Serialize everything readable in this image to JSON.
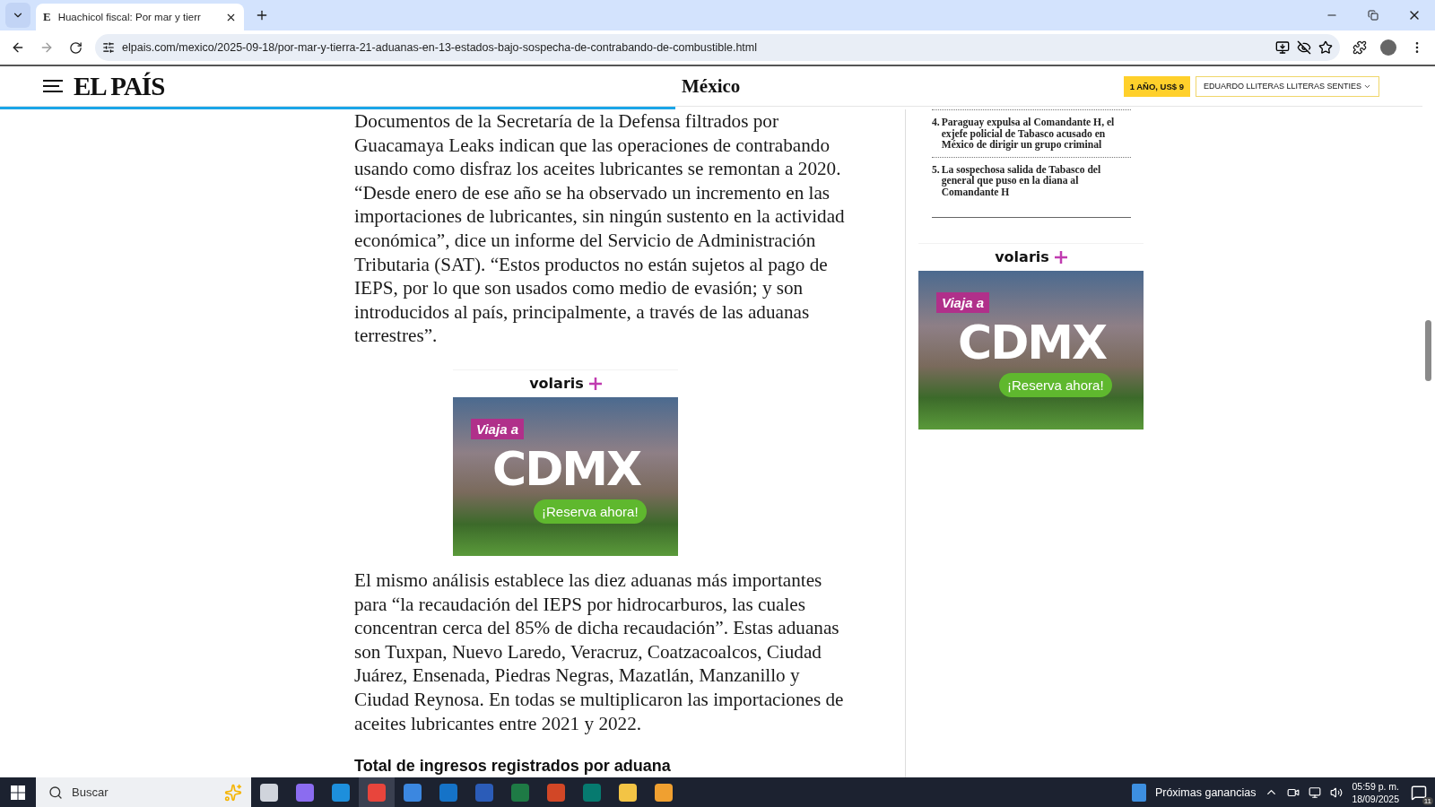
{
  "browser": {
    "tabs": [
      {
        "favicon": "E",
        "title": "Huachicol fiscal: Por mar y tierr",
        "selected": true
      }
    ],
    "url": "elpais.com/mexico/2025-09-18/por-mar-y-tierra-21-aduanas-en-13-estados-bajo-sospecha-de-contrabando-de-combustible.html"
  },
  "site_header": {
    "logo": "EL PAÍS",
    "section": "México",
    "subscribe_button": "1 AÑO, US$ 9",
    "user_menu": "EDUARDO LLITERAS LLITERAS SENTIES",
    "reading_progress": {
      "level": 0.475
    }
  },
  "article": {
    "blocks": [
      {
        "kind": "paragraph",
        "text": "Documentos de la Secretaría de la Defensa filtrados por Guacamaya Leaks indican que las operaciones de contrabando usando como disfraz los aceites lubricantes se remontan a 2020. “Desde enero de ese año se ha observado un incremento en las importaciones de lubricantes, sin ningún sustento en la actividad económica”, dice un informe del Servicio de Administración Tributaria (SAT). “Estos productos no están sujetos al pago de IEPS, por lo que son usados como medio de evasión; y son introducidos al país, principalmente, a través de las aduanas terrestres”."
      },
      {
        "kind": "ad",
        "brand": "volaris",
        "tag": "Viaja a",
        "headline": "CDMX",
        "cta": "¡Reserva ahora!"
      },
      {
        "kind": "paragraph",
        "text": "El mismo análisis establece las diez aduanas más importantes para “la recaudación del IEPS por hidrocarburos, las cuales concentran cerca del 85% de dicha recaudación”. Estas aduanas son Tuxpan, Nuevo Laredo, Veracruz, Coatzacoalcos, Ciudad Juárez, Ensenada, Piedras Negras, Mazatlán, Manzanillo y Ciudad Reynosa. En todas se multiplicaron las importaciones de aceites lubricantes entre 2021 y 2022."
      },
      {
        "kind": "heading",
        "text": "Total de ingresos registrados por aduana"
      }
    ]
  },
  "sidebar": {
    "most_read": [
      {
        "number": "4.",
        "title": "Paraguay expulsa al Comandante H, el exjefe policial de Tabasco acusado en México de dirigir un grupo criminal"
      },
      {
        "number": "5.",
        "title": "La sospechosa salida de Tabasco del general que puso en la diana al Comandante H"
      }
    ],
    "ad": {
      "brand": "volaris",
      "tag": "Viaja a",
      "headline": "CDMX",
      "cta": "¡Reserva ahora!"
    }
  },
  "taskbar": {
    "search_placeholder": "Buscar",
    "apps": [
      {
        "kind": "taskview",
        "selected": false
      },
      {
        "kind": "copilot",
        "selected": false
      },
      {
        "kind": "edge",
        "selected": false
      },
      {
        "kind": "chrome",
        "selected": true
      },
      {
        "kind": "store",
        "selected": false
      },
      {
        "kind": "outlook",
        "selected": false
      },
      {
        "kind": "word",
        "selected": false
      },
      {
        "kind": "excel",
        "selected": false
      },
      {
        "kind": "powerpoint",
        "selected": false
      },
      {
        "kind": "publisher",
        "selected": false
      },
      {
        "kind": "explorer",
        "selected": false
      },
      {
        "kind": "photos",
        "selected": false
      }
    ],
    "widget": "Próximas ganancias",
    "time": "05:59 p. m.",
    "date": "18/09/2025",
    "notifications": "11"
  }
}
